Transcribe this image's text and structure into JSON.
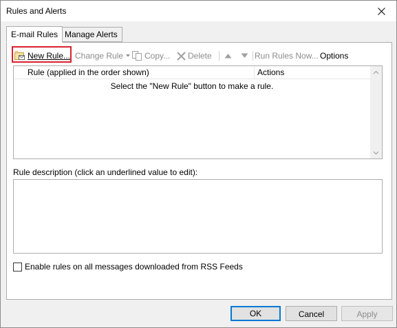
{
  "window": {
    "title": "Rules and Alerts"
  },
  "tabs": [
    {
      "label": "E-mail Rules",
      "active": true
    },
    {
      "label": "Manage Alerts",
      "active": false
    }
  ],
  "toolbar": {
    "new_rule": "New Rule...",
    "change_rule": "Change Rule",
    "copy": "Copy...",
    "delete": "Delete",
    "run_rules_now": "Run Rules Now...",
    "options": "Options"
  },
  "rules_list": {
    "columns": [
      "Rule (applied in the order shown)",
      "Actions"
    ],
    "empty_message": "Select the \"New Rule\" button to make a rule."
  },
  "description": {
    "label": "Rule description (click an underlined value to edit):"
  },
  "rss_checkbox": {
    "label": "Enable rules on all messages downloaded from RSS Feeds",
    "checked": false
  },
  "buttons": {
    "ok": "OK",
    "cancel": "Cancel",
    "apply": "Apply"
  },
  "colors": {
    "highlight": "#d9202f",
    "focus": "#0078d7",
    "disabled_text": "#8c8c8c"
  }
}
